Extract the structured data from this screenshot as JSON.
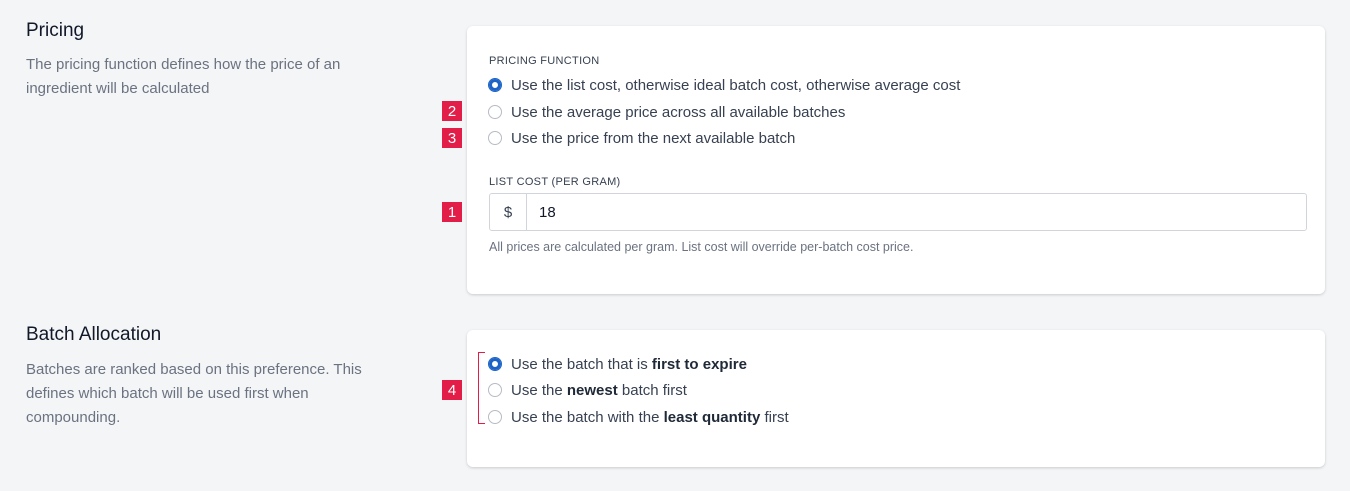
{
  "pricing": {
    "title": "Pricing",
    "description": "The pricing function defines how the price of an ingredient will be calculated",
    "function_caption": "PRICING FUNCTION",
    "options": [
      {
        "label": "Use the list cost, otherwise ideal batch cost, otherwise average cost",
        "checked": true
      },
      {
        "label": "Use the average price across all available batches",
        "checked": false
      },
      {
        "label": "Use the price from the next available batch",
        "checked": false
      }
    ],
    "list_cost_caption": "LIST COST (PER GRAM)",
    "currency_symbol": "$",
    "list_cost_value": "18",
    "help_text": "All prices are calculated per gram. List cost will override per-batch cost price."
  },
  "batch": {
    "title": "Batch Allocation",
    "description": "Batches are ranked based on this preference. This defines which batch will be used first when compounding.",
    "options": [
      {
        "pre": "Use the batch that is ",
        "bold": "first to expire",
        "post": "",
        "checked": true
      },
      {
        "pre": "Use the ",
        "bold": "newest",
        "post": " batch first",
        "checked": false
      },
      {
        "pre": "Use the batch with the ",
        "bold": "least quantity",
        "post": " first",
        "checked": false
      }
    ]
  },
  "markers": {
    "m1": "1",
    "m2": "2",
    "m3": "3",
    "m4": "4"
  },
  "colors": {
    "accent": "#1d63c7",
    "marker": "#e11d48"
  }
}
